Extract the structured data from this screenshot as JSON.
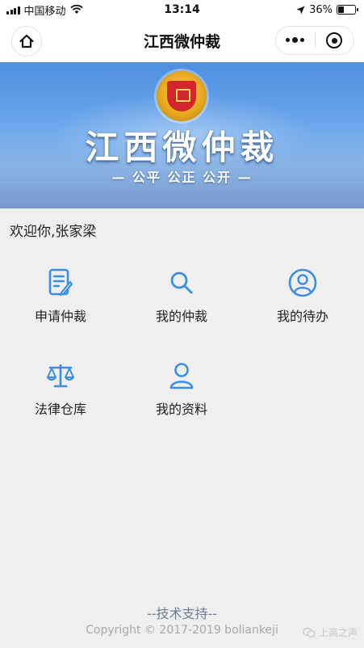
{
  "status_bar": {
    "carrier": "中国移动",
    "time": "13:14",
    "battery": "36%",
    "battery_level": 0.36
  },
  "nav": {
    "title": "江西微仲裁"
  },
  "banner": {
    "title": "江西微仲裁",
    "slogan": "— 公平  公正  公开 —"
  },
  "welcome": "欢迎你,张家梁",
  "menu": [
    {
      "label": "申请仲裁",
      "icon": "edit-form-icon"
    },
    {
      "label": "我的仲裁",
      "icon": "search-icon"
    },
    {
      "label": "我的待办",
      "icon": "user-circle-icon"
    },
    {
      "label": "法律仓库",
      "icon": "scales-icon"
    },
    {
      "label": "我的资料",
      "icon": "user-icon"
    }
  ],
  "footer": {
    "support": "--技术支持--",
    "copyright": "Copyright © 2017-2019 boliankeji"
  },
  "watermark": "上高之声",
  "colors": {
    "accent": "#3a8ee6",
    "background": "#efefef"
  }
}
